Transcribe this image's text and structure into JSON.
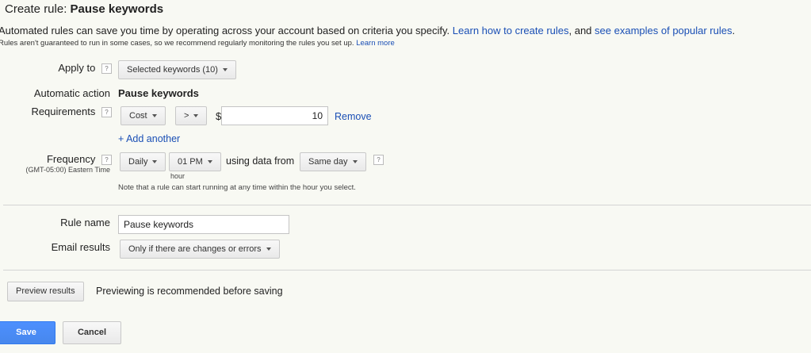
{
  "header": {
    "title_prefix": "Create rule:",
    "title_name": "Pause keywords"
  },
  "intro": {
    "text_before": "Automated rules can save you time by operating across your account based on criteria you specify.",
    "link1": "Learn how to create rules",
    "text_mid": ", and",
    "link2": "see examples of popular rules",
    "text_end": ".",
    "note": "Rules aren't guaranteed to run in some cases, so we recommend regularly monitoring the rules you set up.",
    "note_link": "Learn more"
  },
  "form": {
    "apply_to": {
      "label": "Apply to",
      "value": "Selected keywords (10)"
    },
    "action": {
      "label": "Automatic action",
      "value": "Pause keywords"
    },
    "requirements": {
      "label": "Requirements",
      "metric": "Cost",
      "operator": ">",
      "currency": "$",
      "amount": "10",
      "remove": "Remove",
      "add_another": "+ Add another"
    },
    "frequency": {
      "label": "Frequency",
      "timezone": "(GMT-05:00) Eastern Time",
      "period": "Daily",
      "time": "01 PM",
      "time_caption": "hour",
      "using_text": "using data from",
      "range": "Same day",
      "note": "Note that a rule can start running at any time within the hour you select."
    },
    "rule_name": {
      "label": "Rule name",
      "value": "Pause keywords"
    },
    "email": {
      "label": "Email results",
      "value": "Only if there are changes or errors"
    },
    "help_glyph": "?"
  },
  "preview": {
    "button": "Preview results",
    "note": "Previewing is recommended before saving"
  },
  "footer": {
    "save": "Save",
    "cancel": "Cancel"
  },
  "colors": {
    "link": "#1a4fb5",
    "save_button": "#4d90fe"
  }
}
